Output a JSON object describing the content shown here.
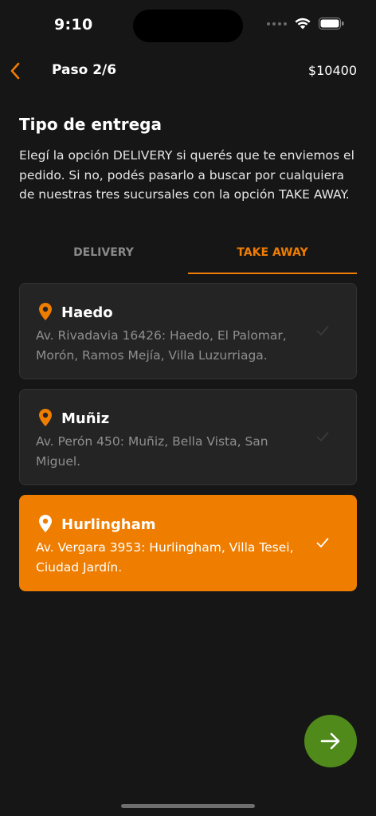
{
  "status_bar": {
    "time": "9:10"
  },
  "nav": {
    "title": "Paso 2/6",
    "total": "$10400"
  },
  "section": {
    "title": "Tipo de entrega",
    "description": "Elegí la opción DELIVERY si querés que te enviemos el pedido. Si no, podés pasarlo a buscar por cualquiera de nuestras tres sucursales con la opción TAKE AWAY."
  },
  "tabs": [
    {
      "label": "DELIVERY",
      "active": false
    },
    {
      "label": "TAKE AWAY",
      "active": true
    }
  ],
  "branches": [
    {
      "name": "Haedo",
      "address": "Av. Rivadavia 16426: Haedo, El Palomar, Morón, Ramos Mejía, Villa Luzurriaga.",
      "selected": false
    },
    {
      "name": "Muñiz",
      "address": "Av. Perón 450: Muñiz, Bella Vista, San Miguel.",
      "selected": false
    },
    {
      "name": "Hurlingham",
      "address": "Av. Vergara 3953: Hurlingham, Villa Tesei, Ciudad Jardín.",
      "selected": true
    }
  ],
  "icons": {
    "back": "chevron-left-icon",
    "pin": "map-pin-icon",
    "check": "check-icon",
    "next": "arrow-right-icon"
  },
  "colors": {
    "accent": "#ef7d00",
    "background": "#161616",
    "card": "#242424",
    "next_button": "#4f8a1a"
  }
}
